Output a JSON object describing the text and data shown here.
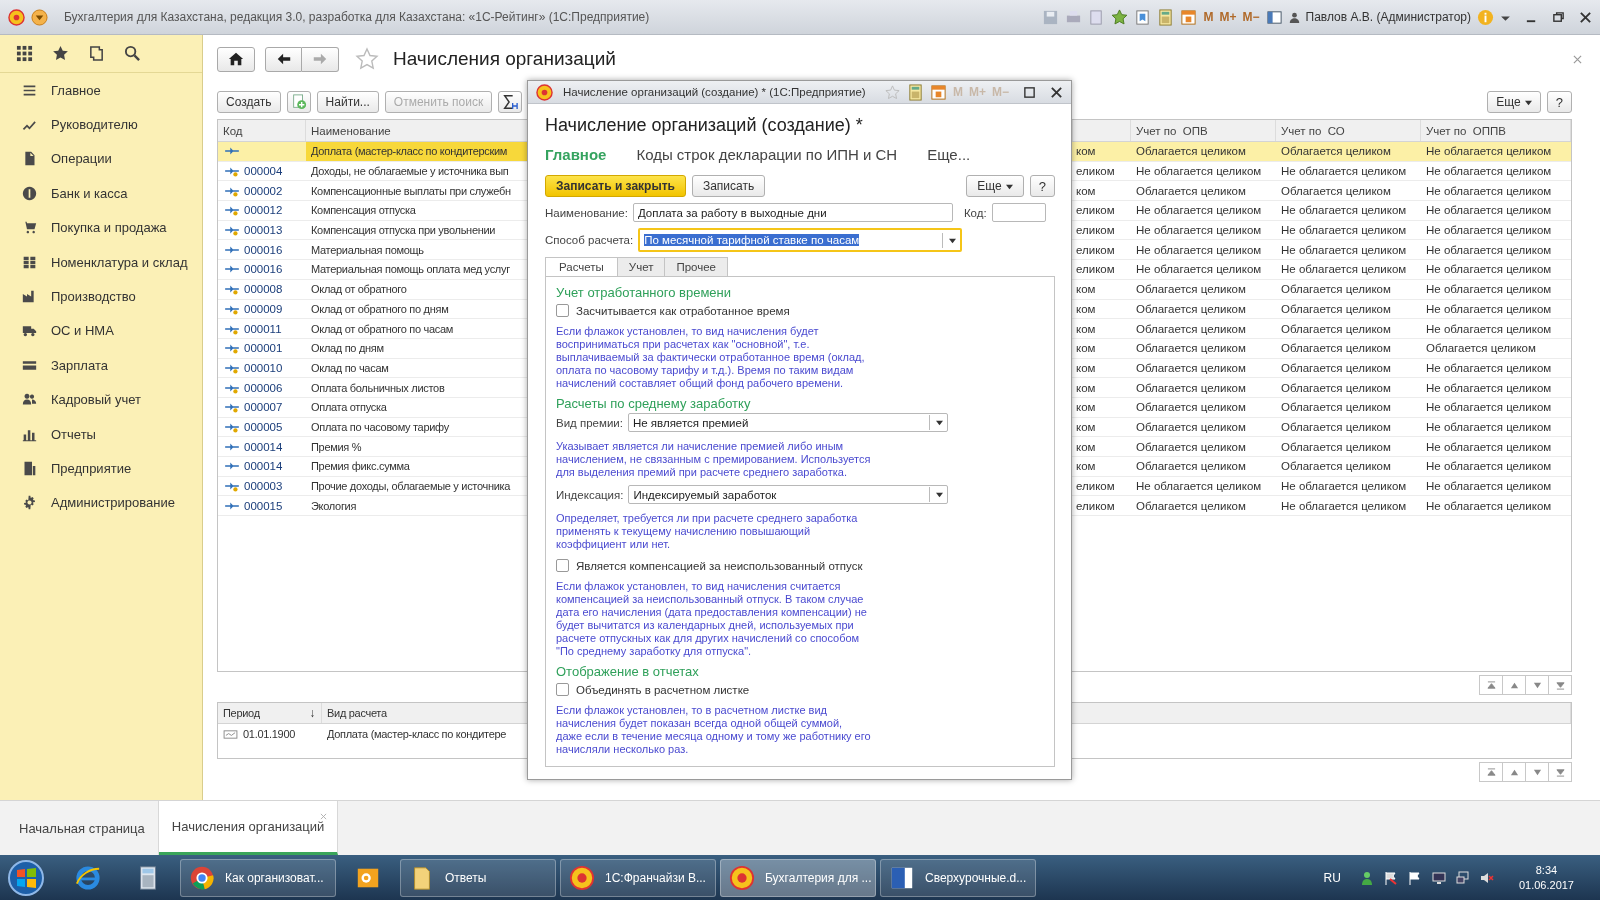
{
  "app_title": "Бухгалтерия для Казахстана, редакция 3.0, разработка для Казахстана: «1С-Рейтинг» (1С:Предприятие)",
  "memory_buttons": [
    "M",
    "M+",
    "M−"
  ],
  "user": "Павлов А.В. (Администратор)",
  "sidebar": {
    "items": [
      {
        "label": "Главное"
      },
      {
        "label": "Руководителю"
      },
      {
        "label": "Операции"
      },
      {
        "label": "Банк и касса"
      },
      {
        "label": "Покупка и продажа"
      },
      {
        "label": "Номенклатура и склад"
      },
      {
        "label": "Производство"
      },
      {
        "label": "ОС и НМА"
      },
      {
        "label": "Зарплата"
      },
      {
        "label": "Кадровый учет"
      },
      {
        "label": "Отчеты"
      },
      {
        "label": "Предприятие"
      },
      {
        "label": "Администрирование"
      }
    ]
  },
  "page": {
    "title": "Начисления организаций",
    "toolbar": [
      {
        "label": "Создать",
        "disabled": false
      },
      {
        "label": "Найти...",
        "disabled": false
      },
      {
        "label": "Отменить поиск",
        "disabled": true
      }
    ],
    "more": "Еще",
    "help": "?"
  },
  "table": {
    "columns": {
      "code": "Код",
      "name": "Наименование",
      "opv": "Учет по  ОПВ",
      "so": "Учет по  СО",
      "oppv": "Учет по  ОППВ"
    },
    "rows": [
      {
        "code": "",
        "name": "Доплата (мастер-класс по кондитерским",
        "column_3": "ком",
        "opv": "Облагается целиком",
        "so": "Облагается целиком",
        "oppv": "Не облагается целиком",
        "selected": true,
        "predefined": false
      },
      {
        "code": "000004",
        "name": "Доходы, не облагаемые у источника вып",
        "column_3": "еликом",
        "opv": "Не облагается целиком",
        "so": "Не облагается целиком",
        "oppv": "Не облагается целиком",
        "selected": false,
        "predefined": true
      },
      {
        "code": "000002",
        "name": "Компенсационные выплаты при служебн",
        "column_3": "ком",
        "opv": "Облагается целиком",
        "so": "Облагается целиком",
        "oppv": "Не облагается целиком",
        "selected": false,
        "predefined": true
      },
      {
        "code": "000012",
        "name": "Компенсация отпуска",
        "column_3": "еликом",
        "opv": "Не облагается целиком",
        "so": "Не облагается целиком",
        "oppv": "Не облагается целиком",
        "selected": false,
        "predefined": true
      },
      {
        "code": "000013",
        "name": "Компенсация отпуска при увольнении",
        "column_3": "еликом",
        "opv": "Не облагается целиком",
        "so": "Не облагается целиком",
        "oppv": "Не облагается целиком",
        "selected": false,
        "predefined": true
      },
      {
        "code": "000016",
        "name": "Материальная помощь",
        "column_3": "еликом",
        "opv": "Не облагается целиком",
        "so": "Не облагается целиком",
        "oppv": "Не облагается целиком",
        "selected": false,
        "predefined": false
      },
      {
        "code": "000016",
        "name": "Материальная помощь оплата мед услуг",
        "column_3": "еликом",
        "opv": "Не облагается целиком",
        "so": "Не облагается целиком",
        "oppv": "Не облагается целиком",
        "selected": false,
        "predefined": false
      },
      {
        "code": "000008",
        "name": "Оклад от обратного",
        "column_3": "ком",
        "opv": "Облагается целиком",
        "so": "Облагается целиком",
        "oppv": "Не облагается целиком",
        "selected": false,
        "predefined": true
      },
      {
        "code": "000009",
        "name": "Оклад от обратного по дням",
        "column_3": "ком",
        "opv": "Облагается целиком",
        "so": "Облагается целиком",
        "oppv": "Не облагается целиком",
        "selected": false,
        "predefined": true
      },
      {
        "code": "000011",
        "name": "Оклад от обратного по часам",
        "column_3": "ком",
        "opv": "Облагается целиком",
        "so": "Облагается целиком",
        "oppv": "Не облагается целиком",
        "selected": false,
        "predefined": true
      },
      {
        "code": "000001",
        "name": "Оклад по дням",
        "column_3": "ком",
        "opv": "Облагается целиком",
        "so": "Облагается целиком",
        "oppv": "Облагается целиком",
        "selected": false,
        "predefined": true
      },
      {
        "code": "000010",
        "name": "Оклад по часам",
        "column_3": "ком",
        "opv": "Облагается целиком",
        "so": "Облагается целиком",
        "oppv": "Не облагается целиком",
        "selected": false,
        "predefined": true
      },
      {
        "code": "000006",
        "name": "Оплата больничных листов",
        "column_3": "ком",
        "opv": "Облагается целиком",
        "so": "Облагается целиком",
        "oppv": "Не облагается целиком",
        "selected": false,
        "predefined": true
      },
      {
        "code": "000007",
        "name": "Оплата отпуска",
        "column_3": "ком",
        "opv": "Облагается целиком",
        "so": "Облагается целиком",
        "oppv": "Не облагается целиком",
        "selected": false,
        "predefined": true
      },
      {
        "code": "000005",
        "name": "Оплата по часовому тарифу",
        "column_3": "ком",
        "opv": "Облагается целиком",
        "so": "Облагается целиком",
        "oppv": "Не облагается целиком",
        "selected": false,
        "predefined": true
      },
      {
        "code": "000014",
        "name": "Премия %",
        "column_3": "ком",
        "opv": "Облагается целиком",
        "so": "Облагается целиком",
        "oppv": "Не облагается целиком",
        "selected": false,
        "predefined": false
      },
      {
        "code": "000014",
        "name": "Премия фикс.сумма",
        "column_3": "ком",
        "opv": "Облагается целиком",
        "so": "Облагается целиком",
        "oppv": "Не облагается целиком",
        "selected": false,
        "predefined": false
      },
      {
        "code": "000003",
        "name": "Прочие доходы, облагаемые у источника",
        "column_3": "еликом",
        "opv": "Не облагается целиком",
        "so": "Не облагается целиком",
        "oppv": "Не облагается целиком",
        "selected": false,
        "predefined": true
      },
      {
        "code": "000015",
        "name": "Экология",
        "column_3": "еликом",
        "opv": "Облагается целиком",
        "so": "Не облагается целиком",
        "oppv": "Не облагается целиком",
        "selected": false,
        "predefined": false
      }
    ]
  },
  "history": {
    "columns": {
      "period": "Период",
      "sort": "↓",
      "name": "Вид расчета"
    },
    "rows": [
      {
        "period": "01.01.1900",
        "name": "Доплата (мастер-класс по кондитере"
      }
    ]
  },
  "tabs": [
    {
      "label": "Начальная страница",
      "selected": false
    },
    {
      "label": "Начисления организаций",
      "selected": true
    }
  ],
  "dialog": {
    "window_title": "Начисление организаций (создание) * (1С:Предприятие)",
    "memory_buttons": [
      "M",
      "M+",
      "M−"
    ],
    "heading": "Начисление организаций (создание) *",
    "nav": [
      {
        "label": "Главное",
        "selected": true
      },
      {
        "label": "Коды строк декларации по ИПН и СН",
        "selected": false
      },
      {
        "label": "Еще...",
        "selected": false
      }
    ],
    "buttons": [
      {
        "label": "Записать и закрыть",
        "kind": "primary"
      },
      {
        "label": "Записать",
        "kind": "normal"
      }
    ],
    "more": "Еще",
    "help": "?",
    "name_field": {
      "label": "Наименование:",
      "value": "Доплата за работу в выходные дни"
    },
    "code_field": {
      "label": "Код:"
    },
    "method_field": {
      "label": "Способ расчета:",
      "value": "По месячной тарифной ставке по часам",
      "focused": true
    },
    "tabs": [
      {
        "label": "Расчеты",
        "selected": true
      },
      {
        "label": "Учет",
        "selected": false
      },
      {
        "label": "Прочее",
        "selected": false
      }
    ],
    "sections": [
      {
        "heading": "Учет отработанного времени",
        "items": [
          {
            "kind": "checkbox",
            "label": "Засчитывается как отработанное время",
            "checked": false
          },
          {
            "kind": "note",
            "text": "Если флажок установлен, то вид начисления будет восприниматься при расчетах как \"основной\", т.е. выплачиваемый за фактически отработанное время (оклад, оплата по часовому тарифу и т.д.). Время по таким видам начислений составляет общий фонд рабочего времени."
          }
        ]
      },
      {
        "heading": "Расчеты по среднему заработку",
        "items": [
          {
            "kind": "select",
            "label": "Вид премии:",
            "value": "Не является премией"
          },
          {
            "kind": "note",
            "text": "Указывает является ли начисление премией либо иным начислением, не связанным с премированием. Используется для выделения премий при расчете среднего заработка."
          },
          {
            "kind": "select",
            "label": "Индексация:",
            "value": "Индексируемый заработок"
          },
          {
            "kind": "note",
            "text": "Определяет, требуется ли при расчете среднего заработка применять к текущему начислению повышающий коэффициент или нет."
          },
          {
            "kind": "checkbox",
            "label": "Является компенсацией за неиспользованный отпуск",
            "checked": false
          },
          {
            "kind": "note",
            "text": "Если флажок установлен, то вид начисления считается компенсацией за неиспользованный отпуск. В таком случае дата его начисления (дата предоставления компенсации) не будет вычитатся из календарных дней, используемых при расчете отпускных как для других начислений со способом \"По среднему заработку для отпуска\"."
          }
        ]
      },
      {
        "heading": "Отображение в отчетах",
        "items": [
          {
            "kind": "checkbox",
            "label": "Объединять в расчетном листке",
            "checked": false
          },
          {
            "kind": "note",
            "text": "Если флажок установлен, то в расчетном листке вид начисления будет показан всегда одной общей суммой, даже если в течение месяца одному и тому же работнику его начисляли несколько раз."
          }
        ]
      }
    ]
  },
  "taskbar": {
    "items": [
      {
        "kind": "browser-ie"
      },
      {
        "kind": "calculator"
      },
      {
        "kind": "chrome",
        "label": "Как организоват...",
        "selected": false
      },
      {
        "kind": "outlook"
      },
      {
        "kind": "folder",
        "label": "Ответы",
        "selected": false
      },
      {
        "kind": "onec",
        "label": "1С:Франчайзи В...",
        "selected": false
      },
      {
        "kind": "onec",
        "label": "Бухгалтерия для ...",
        "selected": true
      },
      {
        "kind": "word",
        "label": "Сверхурочные.d...",
        "selected": false
      }
    ],
    "language": "RU",
    "time": "8:34",
    "date": "01.06.2017"
  }
}
